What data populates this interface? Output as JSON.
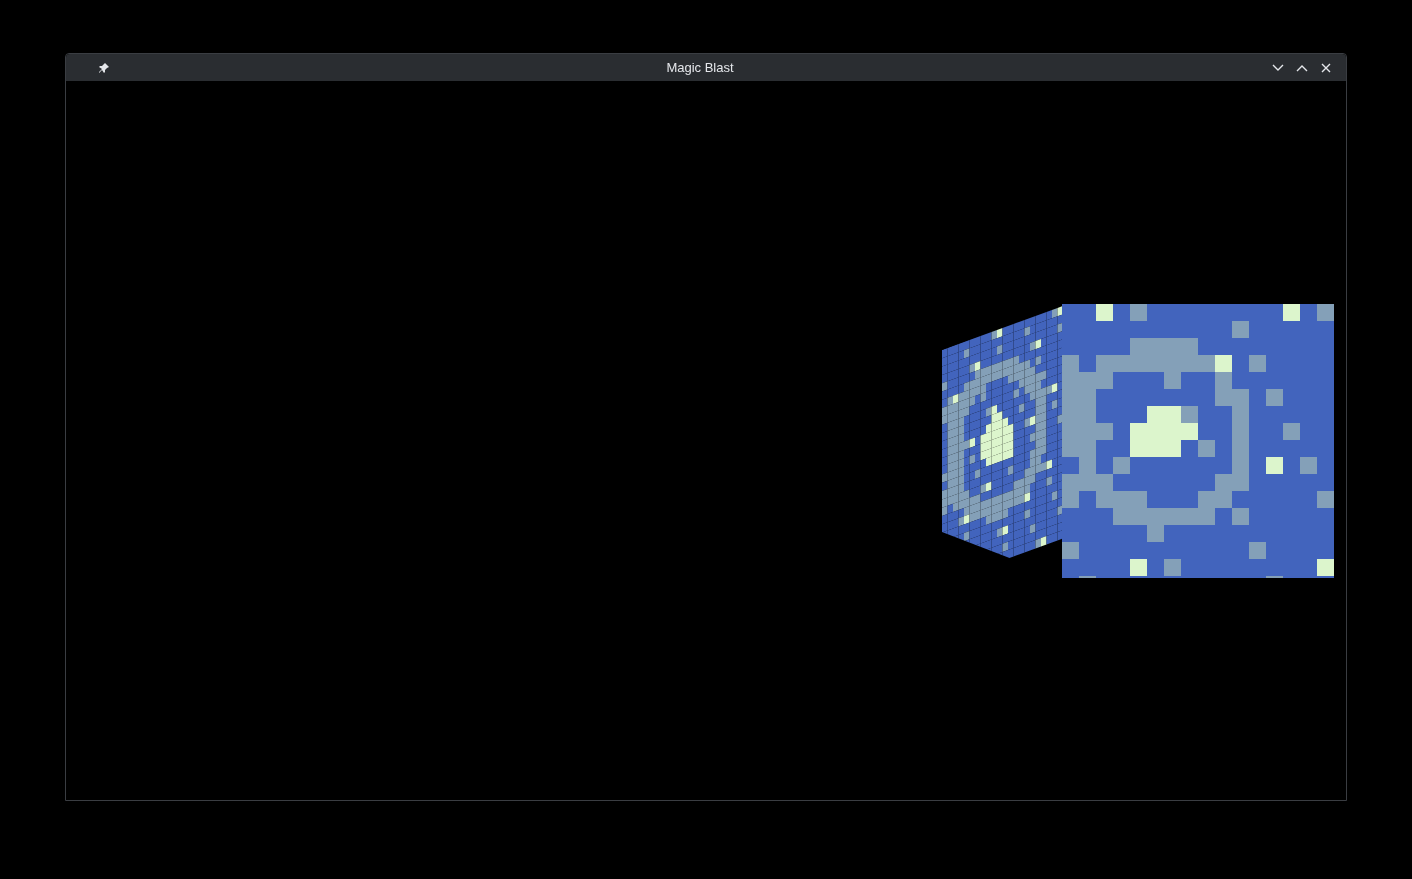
{
  "window": {
    "title": "Magic Blast"
  }
}
